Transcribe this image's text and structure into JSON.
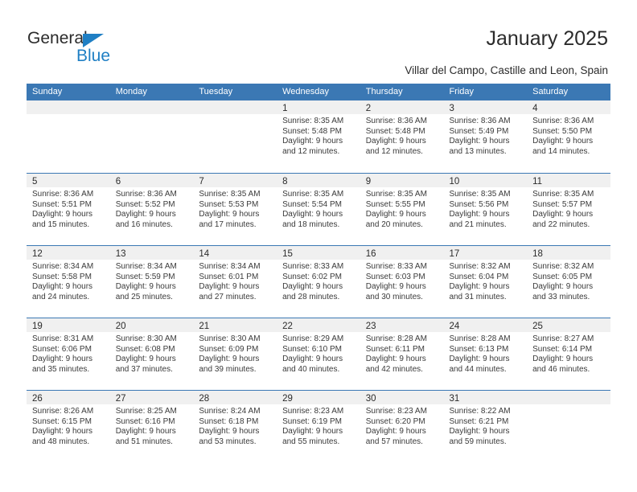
{
  "brand": {
    "name_part1": "General",
    "name_part2": "Blue",
    "accent_color": "#1f7fc4"
  },
  "header": {
    "title": "January 2025",
    "subtitle": "Villar del Campo, Castille and Leon, Spain"
  },
  "theme": {
    "header_row_bg": "#3b78b4",
    "daynum_band_bg": "#f0f0f0",
    "grid_line": "#3b78b4",
    "text": "#2b2b2b"
  },
  "calendar": {
    "weekday_headers": [
      "Sunday",
      "Monday",
      "Tuesday",
      "Wednesday",
      "Thursday",
      "Friday",
      "Saturday"
    ],
    "weeks": [
      [
        {
          "day": "",
          "empty": true
        },
        {
          "day": "",
          "empty": true
        },
        {
          "day": "",
          "empty": true
        },
        {
          "day": "1",
          "sunrise": "Sunrise: 8:35 AM",
          "sunset": "Sunset: 5:48 PM",
          "daylight1": "Daylight: 9 hours",
          "daylight2": "and 12 minutes."
        },
        {
          "day": "2",
          "sunrise": "Sunrise: 8:36 AM",
          "sunset": "Sunset: 5:48 PM",
          "daylight1": "Daylight: 9 hours",
          "daylight2": "and 12 minutes."
        },
        {
          "day": "3",
          "sunrise": "Sunrise: 8:36 AM",
          "sunset": "Sunset: 5:49 PM",
          "daylight1": "Daylight: 9 hours",
          "daylight2": "and 13 minutes."
        },
        {
          "day": "4",
          "sunrise": "Sunrise: 8:36 AM",
          "sunset": "Sunset: 5:50 PM",
          "daylight1": "Daylight: 9 hours",
          "daylight2": "and 14 minutes."
        }
      ],
      [
        {
          "day": "5",
          "sunrise": "Sunrise: 8:36 AM",
          "sunset": "Sunset: 5:51 PM",
          "daylight1": "Daylight: 9 hours",
          "daylight2": "and 15 minutes."
        },
        {
          "day": "6",
          "sunrise": "Sunrise: 8:36 AM",
          "sunset": "Sunset: 5:52 PM",
          "daylight1": "Daylight: 9 hours",
          "daylight2": "and 16 minutes."
        },
        {
          "day": "7",
          "sunrise": "Sunrise: 8:35 AM",
          "sunset": "Sunset: 5:53 PM",
          "daylight1": "Daylight: 9 hours",
          "daylight2": "and 17 minutes."
        },
        {
          "day": "8",
          "sunrise": "Sunrise: 8:35 AM",
          "sunset": "Sunset: 5:54 PM",
          "daylight1": "Daylight: 9 hours",
          "daylight2": "and 18 minutes."
        },
        {
          "day": "9",
          "sunrise": "Sunrise: 8:35 AM",
          "sunset": "Sunset: 5:55 PM",
          "daylight1": "Daylight: 9 hours",
          "daylight2": "and 20 minutes."
        },
        {
          "day": "10",
          "sunrise": "Sunrise: 8:35 AM",
          "sunset": "Sunset: 5:56 PM",
          "daylight1": "Daylight: 9 hours",
          "daylight2": "and 21 minutes."
        },
        {
          "day": "11",
          "sunrise": "Sunrise: 8:35 AM",
          "sunset": "Sunset: 5:57 PM",
          "daylight1": "Daylight: 9 hours",
          "daylight2": "and 22 minutes."
        }
      ],
      [
        {
          "day": "12",
          "sunrise": "Sunrise: 8:34 AM",
          "sunset": "Sunset: 5:58 PM",
          "daylight1": "Daylight: 9 hours",
          "daylight2": "and 24 minutes."
        },
        {
          "day": "13",
          "sunrise": "Sunrise: 8:34 AM",
          "sunset": "Sunset: 5:59 PM",
          "daylight1": "Daylight: 9 hours",
          "daylight2": "and 25 minutes."
        },
        {
          "day": "14",
          "sunrise": "Sunrise: 8:34 AM",
          "sunset": "Sunset: 6:01 PM",
          "daylight1": "Daylight: 9 hours",
          "daylight2": "and 27 minutes."
        },
        {
          "day": "15",
          "sunrise": "Sunrise: 8:33 AM",
          "sunset": "Sunset: 6:02 PM",
          "daylight1": "Daylight: 9 hours",
          "daylight2": "and 28 minutes."
        },
        {
          "day": "16",
          "sunrise": "Sunrise: 8:33 AM",
          "sunset": "Sunset: 6:03 PM",
          "daylight1": "Daylight: 9 hours",
          "daylight2": "and 30 minutes."
        },
        {
          "day": "17",
          "sunrise": "Sunrise: 8:32 AM",
          "sunset": "Sunset: 6:04 PM",
          "daylight1": "Daylight: 9 hours",
          "daylight2": "and 31 minutes."
        },
        {
          "day": "18",
          "sunrise": "Sunrise: 8:32 AM",
          "sunset": "Sunset: 6:05 PM",
          "daylight1": "Daylight: 9 hours",
          "daylight2": "and 33 minutes."
        }
      ],
      [
        {
          "day": "19",
          "sunrise": "Sunrise: 8:31 AM",
          "sunset": "Sunset: 6:06 PM",
          "daylight1": "Daylight: 9 hours",
          "daylight2": "and 35 minutes."
        },
        {
          "day": "20",
          "sunrise": "Sunrise: 8:30 AM",
          "sunset": "Sunset: 6:08 PM",
          "daylight1": "Daylight: 9 hours",
          "daylight2": "and 37 minutes."
        },
        {
          "day": "21",
          "sunrise": "Sunrise: 8:30 AM",
          "sunset": "Sunset: 6:09 PM",
          "daylight1": "Daylight: 9 hours",
          "daylight2": "and 39 minutes."
        },
        {
          "day": "22",
          "sunrise": "Sunrise: 8:29 AM",
          "sunset": "Sunset: 6:10 PM",
          "daylight1": "Daylight: 9 hours",
          "daylight2": "and 40 minutes."
        },
        {
          "day": "23",
          "sunrise": "Sunrise: 8:28 AM",
          "sunset": "Sunset: 6:11 PM",
          "daylight1": "Daylight: 9 hours",
          "daylight2": "and 42 minutes."
        },
        {
          "day": "24",
          "sunrise": "Sunrise: 8:28 AM",
          "sunset": "Sunset: 6:13 PM",
          "daylight1": "Daylight: 9 hours",
          "daylight2": "and 44 minutes."
        },
        {
          "day": "25",
          "sunrise": "Sunrise: 8:27 AM",
          "sunset": "Sunset: 6:14 PM",
          "daylight1": "Daylight: 9 hours",
          "daylight2": "and 46 minutes."
        }
      ],
      [
        {
          "day": "26",
          "sunrise": "Sunrise: 8:26 AM",
          "sunset": "Sunset: 6:15 PM",
          "daylight1": "Daylight: 9 hours",
          "daylight2": "and 48 minutes."
        },
        {
          "day": "27",
          "sunrise": "Sunrise: 8:25 AM",
          "sunset": "Sunset: 6:16 PM",
          "daylight1": "Daylight: 9 hours",
          "daylight2": "and 51 minutes."
        },
        {
          "day": "28",
          "sunrise": "Sunrise: 8:24 AM",
          "sunset": "Sunset: 6:18 PM",
          "daylight1": "Daylight: 9 hours",
          "daylight2": "and 53 minutes."
        },
        {
          "day": "29",
          "sunrise": "Sunrise: 8:23 AM",
          "sunset": "Sunset: 6:19 PM",
          "daylight1": "Daylight: 9 hours",
          "daylight2": "and 55 minutes."
        },
        {
          "day": "30",
          "sunrise": "Sunrise: 8:23 AM",
          "sunset": "Sunset: 6:20 PM",
          "daylight1": "Daylight: 9 hours",
          "daylight2": "and 57 minutes."
        },
        {
          "day": "31",
          "sunrise": "Sunrise: 8:22 AM",
          "sunset": "Sunset: 6:21 PM",
          "daylight1": "Daylight: 9 hours",
          "daylight2": "and 59 minutes."
        },
        {
          "day": "",
          "empty": true
        }
      ]
    ]
  }
}
